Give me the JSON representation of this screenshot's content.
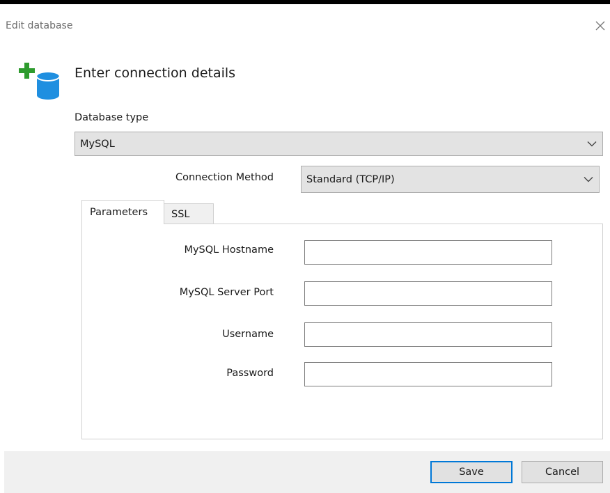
{
  "window": {
    "title": "Edit database",
    "close_icon": "close-icon"
  },
  "header": {
    "title": "Enter connection details",
    "icon": "add-database-icon"
  },
  "database_type": {
    "label": "Database type",
    "value": "MySQL"
  },
  "connection_method": {
    "label": "Connection Method",
    "value": "Standard (TCP/IP)"
  },
  "tabs": [
    {
      "label": "Parameters",
      "active": true
    },
    {
      "label": "SSL",
      "active": false
    }
  ],
  "fields": {
    "hostname": {
      "label": "MySQL Hostname",
      "value": ""
    },
    "port": {
      "label": "MySQL Server Port",
      "value": ""
    },
    "username": {
      "label": "Username",
      "value": ""
    },
    "password": {
      "label": "Password",
      "value": ""
    }
  },
  "buttons": {
    "save": "Save",
    "cancel": "Cancel"
  },
  "colors": {
    "accent": "#0078d7",
    "icon_plus": "#2e9b2e",
    "icon_db": "#1f8fe0"
  }
}
